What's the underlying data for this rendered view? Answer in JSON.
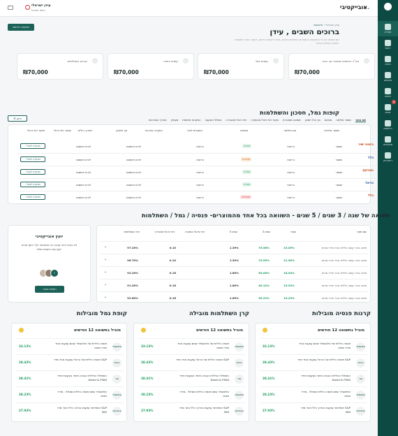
{
  "app": {
    "brand": "אובייקטיבי",
    "user_name": "עידן ישראלי",
    "user_sub": "Israel Idan"
  },
  "sidebar": [
    {
      "label": "תפריט",
      "icon": "home-icon"
    },
    {
      "label": "ראשי",
      "icon": "person-icon"
    },
    {
      "label": "ביטוח",
      "icon": "umbrella-icon"
    },
    {
      "label": "פיננסים",
      "icon": "chart-icon"
    },
    {
      "label": "טיפים",
      "icon": "flag-icon"
    },
    {
      "label": "פניות",
      "icon": "message-icon",
      "badge": "4"
    },
    {
      "label": "הלוואות",
      "icon": "money-icon"
    },
    {
      "label": "משכנתא",
      "icon": "house-icon"
    },
    {
      "label": "ריסטרוק",
      "icon": "refresh-icon"
    }
  ],
  "header": {
    "breadcrumb_root": "עידן ישראלי",
    "breadcrumb_current": "פיננסים",
    "greeting": "ברוכים השבים , עידן",
    "intro": "כאן תמצאו את כל החסכונות והמוצרים הפיננסיים שלכם, תוכלו להשוות ביניהם, לעקוב אחר התשואות ולבצע פעולות בקלות.",
    "add_button": "הפקדה חדשה"
  },
  "summary_cards": [
    {
      "label": "סה\"כ הכספים שנצברו עד היום",
      "value": "₪70,000"
    },
    {
      "label": "קופות גמל",
      "value": "₪70,000"
    },
    {
      "label": "קופות ביטוח",
      "value": "₪70,000"
    },
    {
      "label": "קרנות השתלמות",
      "value": "₪70,000"
    }
  ],
  "funds": {
    "title": "קופות גמל, חסכון והשתלמות",
    "filter_label": "סינון",
    "tabs": [
      "שם מוצר",
      "מספר פוליסה",
      "סטטוס",
      "סך הכל חסכון",
      "תשואה מצטברת",
      "שיעור דמי ניהול מהפקדה",
      "דמי ניהול מהצבירה",
      "מסלול השקעה",
      "הפקדות חודשיות",
      "מעסיק",
      "תאריך הצטרפות"
    ],
    "columns": [
      "מספר פוליסה",
      "סוג פוליסה",
      "סטטוס",
      "הפקדות לגנה",
      "הפקדה אחרונה",
      "סך חיסכון",
      "תאריך ניילות",
      "שיעור דמי ניהול",
      "שיעור דמי ניהול"
    ],
    "rows": [
      {
        "company": "ביטוח ישיר",
        "policy": "מספר",
        "type": "גריאות",
        "status": "פעילה",
        "status_kind": "ok",
        "deposit": "גריאות",
        "last": "לורם איפסום",
        "fee": "לורם איפסום",
        "action": "הפקדה לגמל"
      },
      {
        "company": "כלל",
        "policy": "מספר",
        "type": "גריאות",
        "status": "מושהית",
        "status_kind": "warn",
        "deposit": "גריאות",
        "last": "לורם איפסום",
        "fee": "לורם איפסום",
        "action": "הפקדה לגמל"
      },
      {
        "company": "הפניקס",
        "policy": "מספר",
        "type": "גריאות",
        "status": "פעילה",
        "status_kind": "ok",
        "deposit": "גריאות",
        "last": "לורם איפסום",
        "fee": "לורם איפסום",
        "action": "הפקדה לגמל"
      },
      {
        "company": "הראל",
        "policy": "מספר",
        "type": "גריאות",
        "status": "פעילה",
        "status_kind": "ok",
        "deposit": "גריאות",
        "last": "לורם איפסום",
        "fee": "לורם איפסום",
        "action": "הפקדה לגמל"
      },
      {
        "company": "כלל",
        "policy": "מספר",
        "type": "גריאות",
        "status": "מבוטלת",
        "status_kind": "bad",
        "deposit": "גריאות",
        "last": "לורם איפסום",
        "fee": "לורם איפסום",
        "action": "הפקדה לגמל"
      }
    ]
  },
  "returns": {
    "title": "תשואה של שנה / 3 שנים / 5 שנים - השוואה  בכל אחד מהמוצרים- פנסיה / גמל / השתלמות",
    "columns": [
      "שם מוצר",
      "שנתי",
      "3 שנים",
      "5 שנים",
      "דמי ניהול הפקדה",
      "דמי ניהול מצבירה",
      "דמי השתלמות"
    ],
    "rows": [
      {
        "name": "מיטב בכור קופה כללית אחר מדדי מניות",
        "y1": "23.05%",
        "y3": "76.56%",
        "y5": "1.39%",
        "f1": "0.10",
        "f2": "97.20%"
      },
      {
        "name": "מיטב בכור קופה כללית אחר מדדי מניות",
        "y1": "21.50%",
        "y3": "70.95%",
        "y5": "1.39%",
        "f1": "0.10",
        "f2": "96.70%"
      },
      {
        "name": "מיטב בכור קופה כללית אחר מדדי מניות",
        "y1": "18.94%",
        "y3": "50.00%",
        "y5": "1.60%",
        "f1": "0.16",
        "f2": "92.20%"
      },
      {
        "name": "מיטב בכור קופה כללית אחר מדדי מניות",
        "y1": "15.92%",
        "y3": "40.12%",
        "y5": "1.60%",
        "f1": "0.16",
        "f2": "91.30%"
      },
      {
        "name": "מיטב בכור קופה כללית אחר מדדי מניות",
        "y1": "10.23%",
        "y3": "30.23%",
        "y5": "1.60%",
        "f1": "0.16",
        "f2": "92.60%"
      }
    ]
  },
  "advisor": {
    "title": "יועץ אובייקטיבי",
    "text": "לא בטוח איזה קופה הכי מתאימה לך? הזמן שיחת ייעוץ עם היועצים שלנו",
    "button": "הזמינו שיחה"
  },
  "mobile": [
    {
      "title": "קרנות פנסיה מובילות",
      "header": "מוביל בתשואה 12 חודשים",
      "items": [
        {
          "text": "פנסיה כללית של אלטשולר שחם עוקבת אחר מדדי מניות",
          "pct": "33.13%",
          "logo": "אלטשולר"
        },
        {
          "text": "פנסיה כללית של הראל עוקבת אחר מדד S&P",
          "pct": "28.43%",
          "logo": "הראל"
        },
        {
          "text": "המסלול הכללית הגבוה ביותר בעקבות מדד David & P500",
          "pct": "28.41%",
          "logo": "מור"
        },
        {
          "text": "אלטשולר שחם פנסיה כללית מסלול - מדדי מניות",
          "pct": "28.23%",
          "logo": "אלטשולר"
        },
        {
          "text": "אינפיניטי עוקבת בנדרך כלל אחר מדד S&P 500",
          "pct": "27.93%",
          "logo": "אינפיניטי"
        }
      ]
    },
    {
      "title": "קרן השתלמות מובילה",
      "header": "מוביל בתשואה 12 חודשים",
      "items": [
        {
          "text": "פנסיה כללית של אלטשולר שחם עוקבת אחר מדדי מניות",
          "pct": "33.13%",
          "logo": "אלטשולר"
        },
        {
          "text": "פנסיה כללית של הראל עוקבת אחר מדד S&P",
          "pct": "28.43%",
          "logo": "הראל"
        },
        {
          "text": "המסלול הכללית הגבוה ביותר בעקבות מדד David & P500",
          "pct": "28.41%",
          "logo": "מור"
        },
        {
          "text": "אלטשולר שחם פנסיה כללית מסלול - מדדי מניות",
          "pct": "28.23%",
          "logo": "אלטשולר"
        },
        {
          "text": "אינפיניטי עוקבת בנדרך כלל אחר מדד S&P 500",
          "pct": "27.93%",
          "logo": "אינפיניטי"
        }
      ]
    },
    {
      "title": "קופת גמל מובילות",
      "header": "מוביל בתשואה 12 חודשים",
      "items": [
        {
          "text": "פנסיה כללית של אלטשולר שחם עוקבת אחר מדדי מניות",
          "pct": "33.13%",
          "logo": "אלטשולר"
        },
        {
          "text": "פנסיה כללית של הראל עוקבת אחר מדד S&P",
          "pct": "28.43%",
          "logo": "הראל"
        },
        {
          "text": "המסלול הכללית הגבוה ביותר בעקבות מדד David & P500",
          "pct": "28.41%",
          "logo": "מור"
        },
        {
          "text": "אלטשולר שחם פנסיה כללית מסלול - מדדי מניות",
          "pct": "28.23%",
          "logo": "אלטשולר"
        },
        {
          "text": "אינפיניטי עוקבת בנדרך כלל אחר מדד S&P 500",
          "pct": "27.93%",
          "logo": "אינפיניטי"
        }
      ]
    }
  ],
  "colors": {
    "primary": "#1b6157",
    "sidebar": "#0d4a44",
    "positive": "#1a9a5c",
    "background": "#f4f6f7"
  }
}
